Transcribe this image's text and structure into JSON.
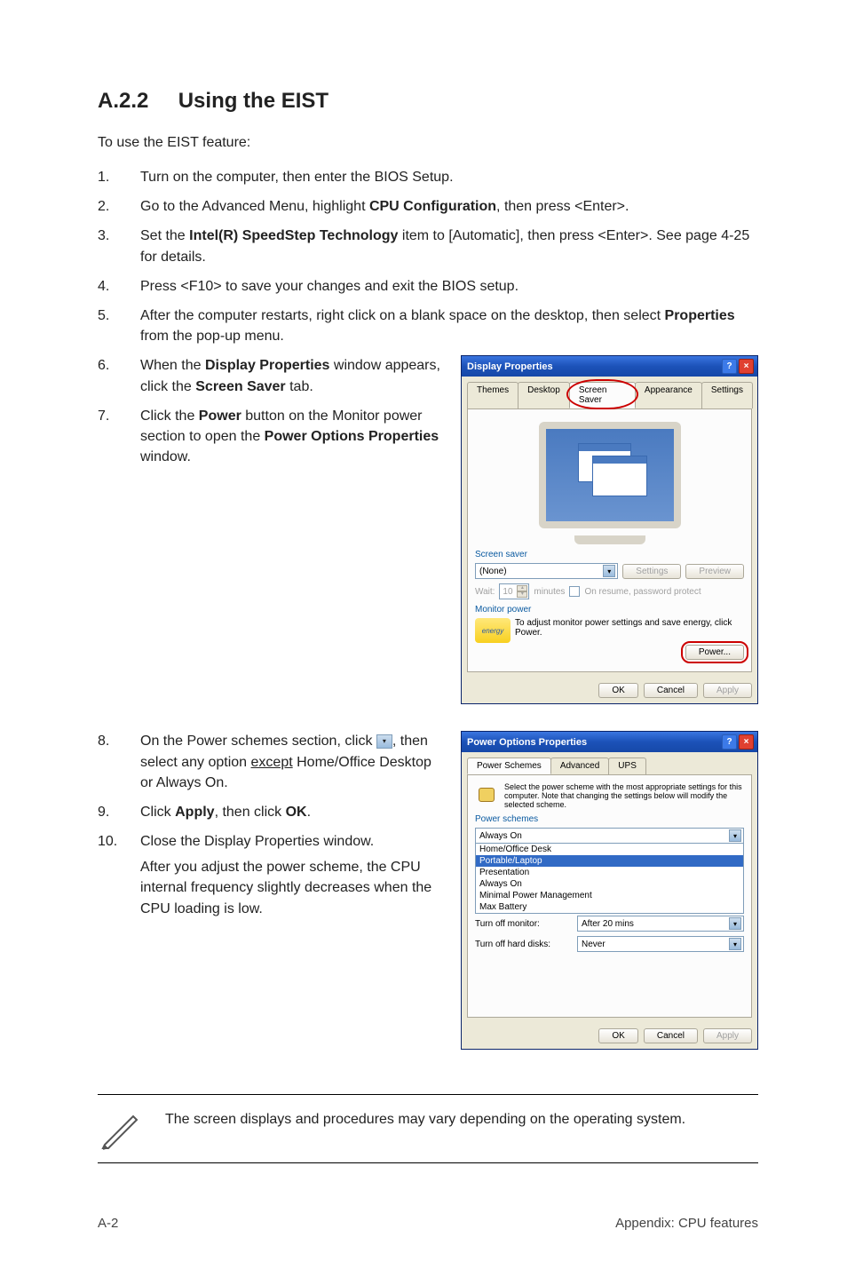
{
  "section": {
    "number": "A.2.2",
    "title": "Using the EIST"
  },
  "intro": "To use the EIST feature:",
  "steps": {
    "s1": "Turn on the computer, then enter the BIOS Setup.",
    "s2a": "Go to the Advanced Menu, highlight ",
    "s2b": "CPU Configuration",
    "s2c": ", then press <Enter>.",
    "s3a": "Set the ",
    "s3b": "Intel(R) SpeedStep Technology",
    "s3c": " item to [Automatic], then press <Enter>. See page 4-25 for details.",
    "s4": "Press <F10> to save your changes and exit the BIOS setup.",
    "s5a": "After the computer restarts, right click on a blank space on the desktop, then select ",
    "s5b": "Properties",
    "s5c": " from the pop-up menu.",
    "s6a": "When the ",
    "s6b": "Display Properties",
    "s6c": " window appears, click the ",
    "s6d": "Screen Saver",
    "s6e": " tab.",
    "s7a": "Click the ",
    "s7b": "Power",
    "s7c": " button on the Monitor power section to open the ",
    "s7d": "Power Options Properties",
    "s7e": " window.",
    "s8a": "On the Power schemes section, click ",
    "s8b": ", then select any option ",
    "s8c": "except",
    "s8d": " Home/Office Desktop or Always On.",
    "s9a": "Click ",
    "s9b": "Apply",
    "s9c": ", then click ",
    "s9d": "OK",
    "s9e": ".",
    "s10a": "Close the Display Properties window.",
    "s10b": "After you adjust the power scheme, the CPU internal frequency slightly decreases when the CPU loading is low."
  },
  "display_dialog": {
    "title": "Display Properties",
    "tabs": [
      "Themes",
      "Desktop",
      "Screen Saver",
      "Appearance",
      "Settings"
    ],
    "group_screensaver": "Screen saver",
    "ss_value": "(None)",
    "btn_settings": "Settings",
    "btn_preview": "Preview",
    "wait_label": "Wait:",
    "wait_value": "10",
    "wait_unit": "minutes",
    "resume_label": "On resume, password protect",
    "group_monitor": "Monitor power",
    "monitor_text": "To adjust monitor power settings and save energy, click Power.",
    "btn_power": "Power...",
    "btn_ok": "OK",
    "btn_cancel": "Cancel",
    "btn_apply": "Apply"
  },
  "power_dialog": {
    "title": "Power Options Properties",
    "tabs": [
      "Power Schemes",
      "Advanced",
      "UPS"
    ],
    "desc": "Select the power scheme with the most appropriate settings for this computer. Note that changing the settings below will modify the selected scheme.",
    "group_schemes": "Power schemes",
    "scheme_value": "Always On",
    "scheme_options": [
      "Home/Office Desk",
      "Portable/Laptop",
      "Presentation",
      "Always On",
      "Minimal Power Management",
      "Max Battery"
    ],
    "monitor_label": "Turn off monitor:",
    "monitor_value": "After 20 mins",
    "hd_label": "Turn off hard disks:",
    "hd_value": "Never",
    "btn_ok": "OK",
    "btn_cancel": "Cancel",
    "btn_apply": "Apply"
  },
  "note": "The screen displays and procedures may vary depending on the operating system.",
  "footer": {
    "left": "A-2",
    "right": "Appendix: CPU features"
  }
}
